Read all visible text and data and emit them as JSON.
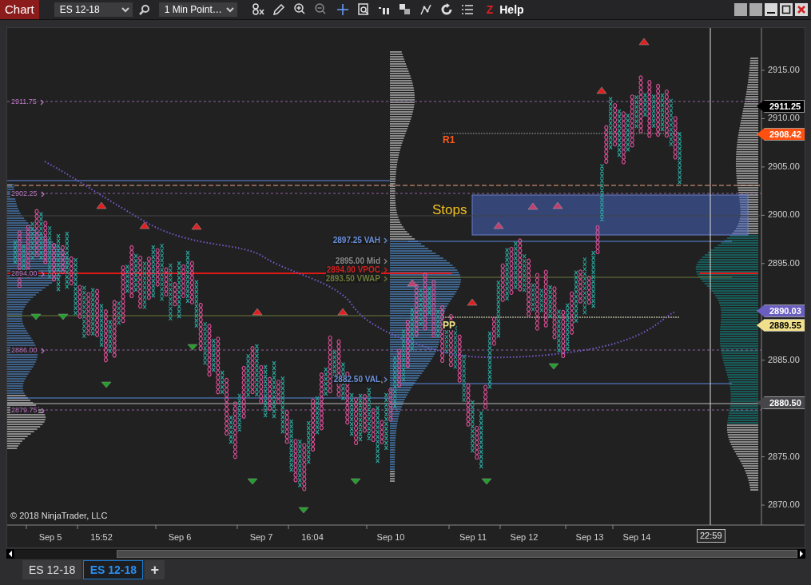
{
  "toolbar": {
    "title": "Chart",
    "instrument": "ES 12-18",
    "interval": "1 Min Point…",
    "hotkey": "Z",
    "help": "Help"
  },
  "chart": {
    "level_labels": [
      "2911.75",
      "2902.25",
      "2894.00",
      "2886.00",
      "2879.75"
    ],
    "study_labels": [
      {
        "text": "2897.25 VAH",
        "color": "#6a8fd8"
      },
      {
        "text": "2895.00 Mid",
        "color": "#8a8a8a"
      },
      {
        "text": "2894.00 VPOC",
        "color": "#d02020"
      },
      {
        "text": "2893.50 VWAP",
        "color": "#6b7a3a"
      },
      {
        "text": "2882.50 VAL",
        "color": "#6a8fd8"
      }
    ],
    "pivot_labels": [
      {
        "text": "R1",
        "color": "#ff5a1a"
      },
      {
        "text": "PP",
        "color": "#f2e68c"
      }
    ],
    "zone_label": "Stops",
    "price_axis": [
      "2915.00",
      "2910.00",
      "2905.00",
      "2900.00",
      "2895.00",
      "2885.00",
      "2875.00",
      "2870.00"
    ],
    "price_badges": [
      {
        "text": "2911.25",
        "color": "#000000"
      },
      {
        "text": "2908.42",
        "color": "#ff5010"
      },
      {
        "text": "2890.03",
        "color": "#6a5fc0"
      },
      {
        "text": "2889.55",
        "color": "#f0e08c"
      },
      {
        "text": "2880.50",
        "color": "#45454a"
      }
    ],
    "time_axis": [
      "Sep 5",
      "15:52",
      "Sep 6",
      "Sep 7",
      "16:04",
      "Sep 10",
      "Sep 11",
      "Sep 12",
      "Sep 13",
      "Sep 14"
    ],
    "cursor_time": "22:59",
    "copyright": "© 2018 NinjaTrader, LLC"
  },
  "tabs": [
    {
      "label": "ES 12-18",
      "selected": false
    },
    {
      "label": "ES 12-18",
      "selected": true
    }
  ],
  "add_tab": "+"
}
